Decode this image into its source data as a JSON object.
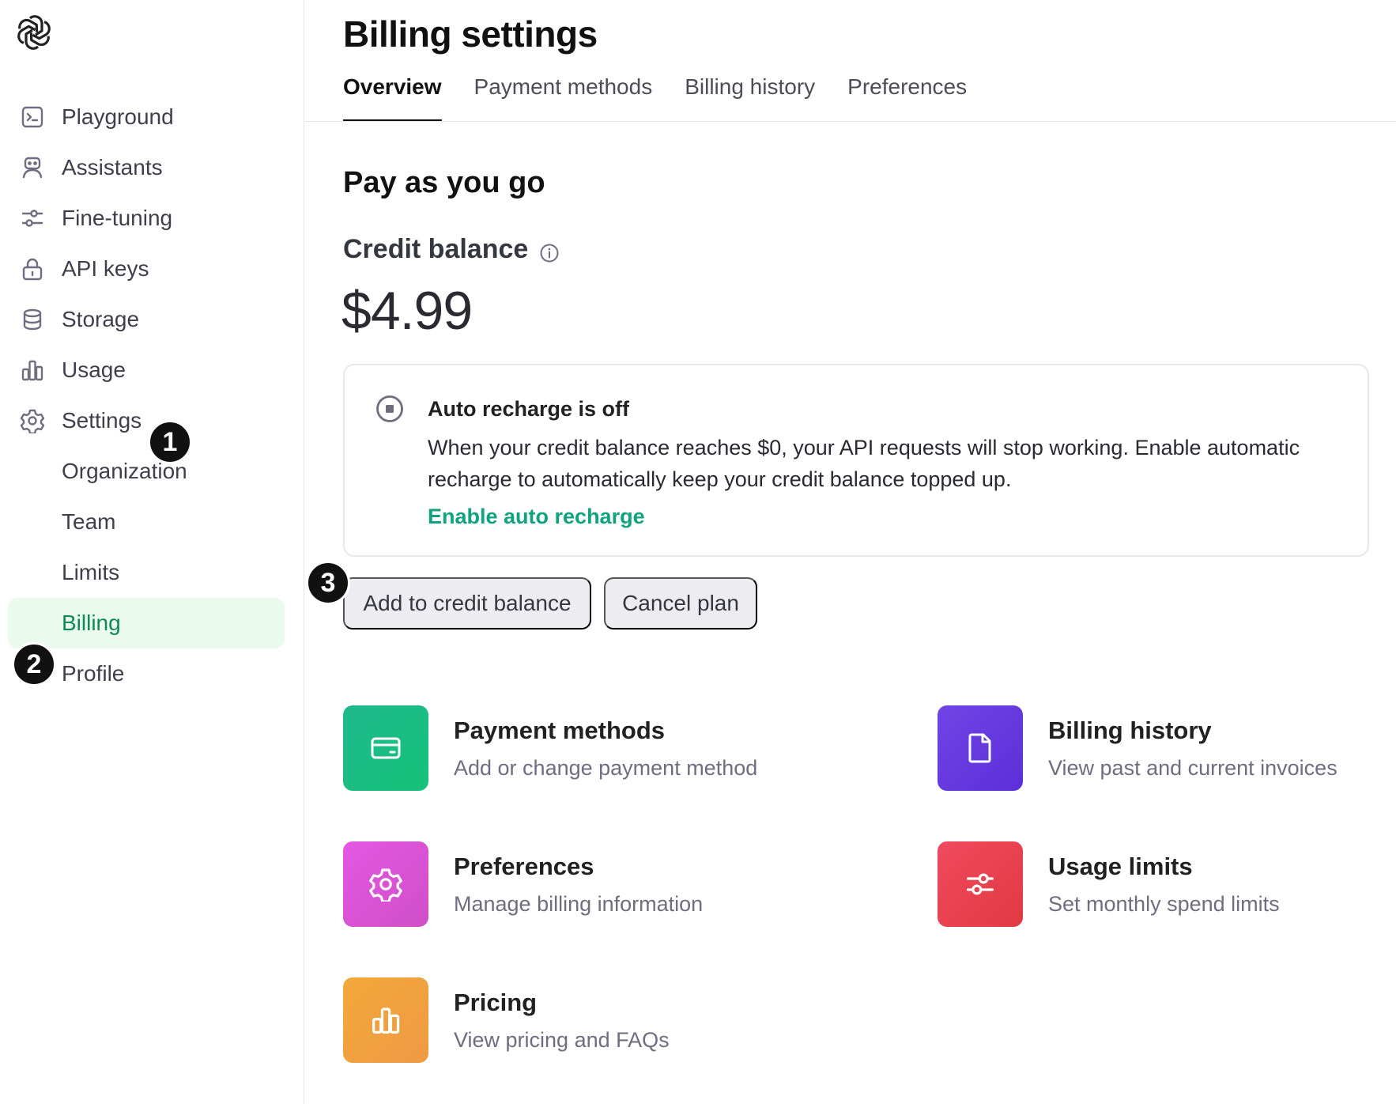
{
  "sidebar": {
    "logo": "openai-logo",
    "items": [
      {
        "label": "Playground",
        "icon": "terminal-icon"
      },
      {
        "label": "Assistants",
        "icon": "robot-icon"
      },
      {
        "label": "Fine-tuning",
        "icon": "sliders-icon"
      },
      {
        "label": "API keys",
        "icon": "lock-icon"
      },
      {
        "label": "Storage",
        "icon": "database-icon"
      },
      {
        "label": "Usage",
        "icon": "bar-chart-icon"
      },
      {
        "label": "Settings",
        "icon": "gear-icon"
      }
    ],
    "sub_items": [
      {
        "label": "Organization"
      },
      {
        "label": "Team"
      },
      {
        "label": "Limits"
      },
      {
        "label": "Billing",
        "active": true
      },
      {
        "label": "Profile"
      }
    ]
  },
  "badges": {
    "one": "1",
    "two": "2",
    "three": "3"
  },
  "header": {
    "title": "Billing settings",
    "tabs": [
      {
        "label": "Overview",
        "active": true
      },
      {
        "label": "Payment methods"
      },
      {
        "label": "Billing history"
      },
      {
        "label": "Preferences"
      }
    ]
  },
  "plan": {
    "title": "Pay as you go",
    "credit_label": "Credit balance",
    "credit_amount": "$4.99"
  },
  "auto_recharge": {
    "title": "Auto recharge is off",
    "text": "When your credit balance reaches $0, your API requests will stop working. Enable automatic recharge to automatically keep your credit balance topped up.",
    "link": "Enable auto recharge"
  },
  "actions": {
    "add_label": "Add to credit balance",
    "cancel_label": "Cancel plan"
  },
  "cards": [
    {
      "title": "Payment methods",
      "subtitle": "Add or change payment method",
      "icon": "credit-card-icon",
      "color": "#19b38a"
    },
    {
      "title": "Billing history",
      "subtitle": "View past and current invoices",
      "icon": "document-icon",
      "color": "#6a3ae0"
    },
    {
      "title": "Preferences",
      "subtitle": "Manage billing information",
      "icon": "gear-icon",
      "color": "#d94fd6"
    },
    {
      "title": "Usage limits",
      "subtitle": "Set monthly spend limits",
      "icon": "sliders-icon",
      "color": "#ea3f50"
    },
    {
      "title": "Pricing",
      "subtitle": "View pricing and FAQs",
      "icon": "bar-chart-icon",
      "color": "#f0a03c"
    }
  ],
  "colors": {
    "accent": "#10a37f",
    "active_bg": "#eafaee",
    "active_text": "#0f8a54"
  }
}
